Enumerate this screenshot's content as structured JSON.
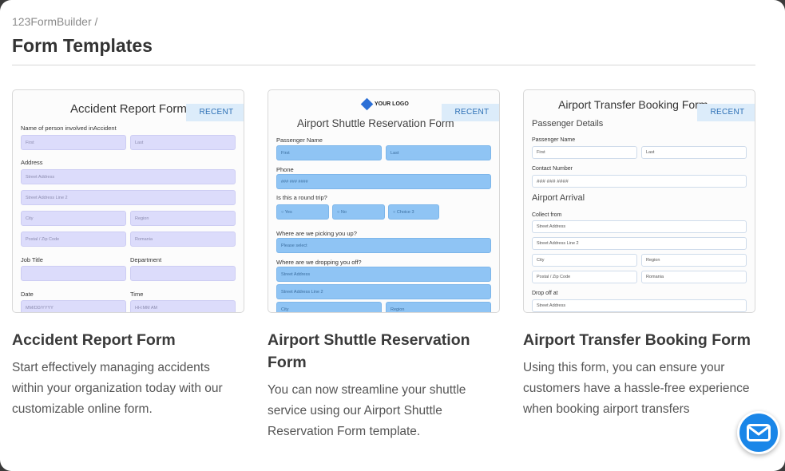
{
  "breadcrumb": "123FormBuilder /",
  "page_title": "Form Templates",
  "badge_label": "RECENT",
  "cards": [
    {
      "title": "Accident Report Form",
      "description": "Start effectively managing accidents within your organization today with our customizable online form.",
      "preview": {
        "heading": "Accident Report Form",
        "label_person": "Name of person involved inAccident",
        "ph_first": "First",
        "ph_last": "Last",
        "label_address": "Address",
        "ph_street": "Street Address",
        "ph_street2": "Street Address Line 2",
        "ph_city": "City",
        "ph_region": "Region",
        "ph_postal": "Postal / Zip Code",
        "ph_country": "Romania",
        "label_job": "Job Title",
        "label_dept": "Department",
        "label_date": "Date",
        "label_time": "Time",
        "ph_date": "MM/DD/YYYY",
        "ph_time": "HH:MM AM"
      }
    },
    {
      "title": "Airport Shuttle Reservation Form",
      "description": "You can now streamline your shuttle service using our Airport Shuttle Reservation Form template.",
      "preview": {
        "logo_text": "YOUR LOGO",
        "heading": "Airport Shuttle Reservation Form",
        "label_passenger": "Passenger Name",
        "ph_first": "First",
        "ph_last": "Last",
        "label_phone": "Phone",
        "ph_phone": "### ### ####",
        "label_round": "Is this a round trip?",
        "opt_yes": "Yes",
        "opt_no": "No",
        "opt_choice3": "Choice 3",
        "label_pickup": "Where are we picking you up?",
        "ph_select": "Please select",
        "label_dropoff": "Where are we dropping you off?",
        "ph_street": "Street Address",
        "ph_street2": "Street Address Line 2",
        "ph_city": "City",
        "ph_region": "Region"
      }
    },
    {
      "title": "Airport Transfer Booking Form",
      "description": "Using this form, you can ensure your customers have a hassle-free experience when booking airport transfers",
      "preview": {
        "heading": "Airport Transfer Booking Form",
        "section_passenger": "Passenger Details",
        "label_passenger": "Passenger Name",
        "ph_first": "First",
        "ph_last": "Last",
        "label_contact": "Contact Number",
        "ph_phone": "### ### ####",
        "section_arrival": "Airport Arrival",
        "label_collect": "Collect from",
        "ph_street": "Street Address",
        "ph_street2": "Street Address Line 2",
        "ph_city": "City",
        "ph_region": "Region",
        "ph_postal": "Postal / Zip Code",
        "ph_country": "Romania",
        "label_dropoff": "Drop off at",
        "ph_street_b": "Street Address"
      }
    }
  ],
  "chat_icon": "envelope-icon"
}
